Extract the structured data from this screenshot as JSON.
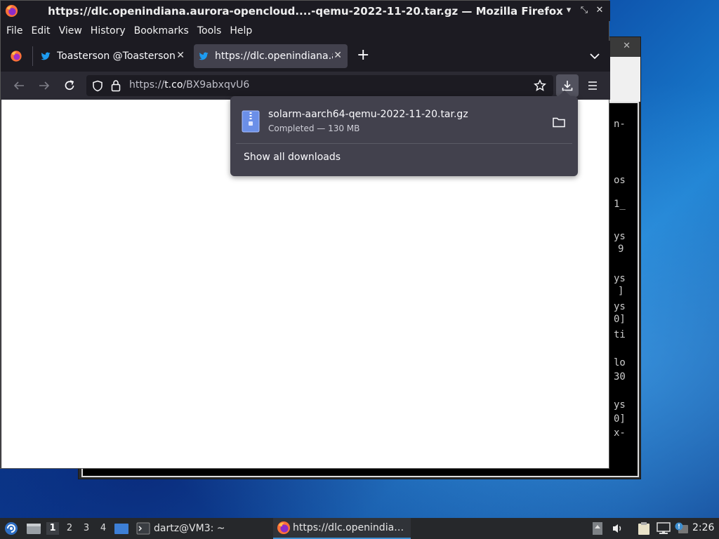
{
  "firefox": {
    "window_title": "https://dlc.openindiana.aurora-opencloud....-qemu-2022-11-20.tar.gz — Mozilla Firefox",
    "menu": [
      "File",
      "Edit",
      "View",
      "History",
      "Bookmarks",
      "Tools",
      "Help"
    ],
    "tabs": [
      {
        "label": "Toasterson @Toasterson@",
        "active": false
      },
      {
        "label": "https://dlc.openindiana.a",
        "active": true
      }
    ],
    "url": {
      "prefix": "https://",
      "host": "t.co",
      "path": "/BX9abxqvU6"
    },
    "downloads_panel": {
      "file_name": "solarm-aarch64-qemu-2022-11-20.tar.gz",
      "status": "Completed — 130 MB",
      "show_all": "Show all downloads"
    }
  },
  "terminal_fragments": [
    "n-",
    "os",
    "1_",
    "ys",
    "9",
    "ys",
    "]",
    "ys",
    "0]",
    "ti",
    "lo",
    "30",
    "ys",
    "0]",
    "x-"
  ],
  "taskbar": {
    "workspaces": [
      "1",
      "2",
      "3",
      "4"
    ],
    "terminal_task": "dartz@VM3: ~",
    "firefox_task": "https://dlc.openindia…",
    "clock": "2:26"
  },
  "colors": {
    "accent": "#3d8fd1",
    "ff_bg": "#1c1b22",
    "panel_bg": "#42414d"
  }
}
